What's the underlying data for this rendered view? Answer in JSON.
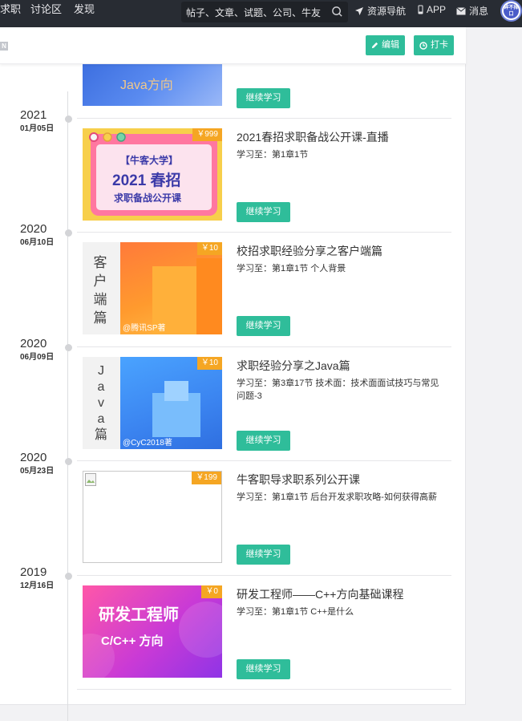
{
  "topnav": {
    "links": [
      "求职",
      "讨论区",
      "发现"
    ],
    "search_placeholder": "帖子、文章、试题、公司、牛友",
    "resource_nav": "资源导航",
    "app": "APP",
    "messages": "消息",
    "avatar_text": "碎不择口"
  },
  "header": {
    "badge": "N",
    "edit_label": "编辑",
    "checkin_label": "打卡"
  },
  "top_partial": {
    "thumb_text": "Java方向",
    "continue_label": "继续学习"
  },
  "courses": [
    {
      "year": "2021",
      "day": "01月05日",
      "price": "￥999",
      "title": "2021春招求职备战公开课-直播",
      "progress": "学习至：第1章1节",
      "continue_label": "继续学习",
      "thumb": {
        "line1": "【牛客大学】",
        "line2": "2021 春招",
        "line3": "求职备战公开课"
      }
    },
    {
      "year": "2020",
      "day": "06月10日",
      "price": "￥10",
      "title": "校招求职经验分享之客户端篇",
      "progress": "学习至：第1章1节 个人背景",
      "continue_label": "继续学习",
      "thumb": {
        "side": [
          "客",
          "户",
          "端",
          "篇"
        ],
        "author": "@腾讯SP著"
      }
    },
    {
      "year": "2020",
      "day": "06月09日",
      "price": "￥10",
      "title": "求职经验分享之Java篇",
      "progress": "学习至：第3章17节 技术面：技术面面试技巧与常见问题-3",
      "continue_label": "继续学习",
      "thumb": {
        "side": [
          "J",
          "a",
          "v",
          "a",
          "篇"
        ],
        "author": "@CyC2018著"
      }
    },
    {
      "year": "2020",
      "day": "05月23日",
      "price": "￥199",
      "title": "牛客职导求职系列公开课",
      "progress": "学习至：第1章1节 后台开发求职攻略-如何获得高薪",
      "continue_label": "继续学习"
    },
    {
      "year": "2019",
      "day": "12月16日",
      "price": "￥0",
      "title": "研发工程师——C++方向基础课程",
      "progress": "学习至：第1章1节 C++是什么",
      "continue_label": "继续学习",
      "thumb": {
        "line1": "研发工程师",
        "line2": "C/C++ 方向"
      }
    }
  ],
  "colors": {
    "accent": "#2fbd9a",
    "price": "#f5a623",
    "nav_bg": "#282c33"
  }
}
